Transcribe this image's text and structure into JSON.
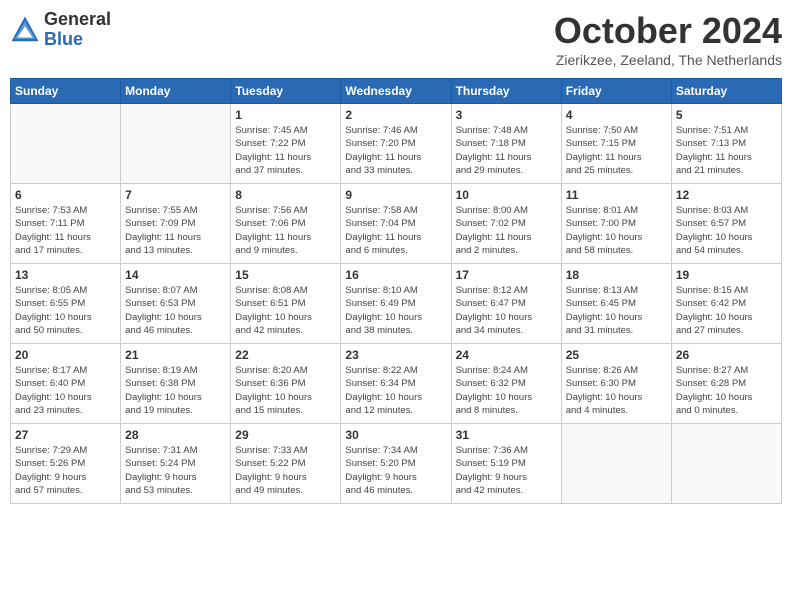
{
  "logo": {
    "general": "General",
    "blue": "Blue"
  },
  "title": "October 2024",
  "location": "Zierikzee, Zeeland, The Netherlands",
  "weekdays": [
    "Sunday",
    "Monday",
    "Tuesday",
    "Wednesday",
    "Thursday",
    "Friday",
    "Saturday"
  ],
  "weeks": [
    [
      {
        "day": "",
        "info": ""
      },
      {
        "day": "",
        "info": ""
      },
      {
        "day": "1",
        "info": "Sunrise: 7:45 AM\nSunset: 7:22 PM\nDaylight: 11 hours\nand 37 minutes."
      },
      {
        "day": "2",
        "info": "Sunrise: 7:46 AM\nSunset: 7:20 PM\nDaylight: 11 hours\nand 33 minutes."
      },
      {
        "day": "3",
        "info": "Sunrise: 7:48 AM\nSunset: 7:18 PM\nDaylight: 11 hours\nand 29 minutes."
      },
      {
        "day": "4",
        "info": "Sunrise: 7:50 AM\nSunset: 7:15 PM\nDaylight: 11 hours\nand 25 minutes."
      },
      {
        "day": "5",
        "info": "Sunrise: 7:51 AM\nSunset: 7:13 PM\nDaylight: 11 hours\nand 21 minutes."
      }
    ],
    [
      {
        "day": "6",
        "info": "Sunrise: 7:53 AM\nSunset: 7:11 PM\nDaylight: 11 hours\nand 17 minutes."
      },
      {
        "day": "7",
        "info": "Sunrise: 7:55 AM\nSunset: 7:09 PM\nDaylight: 11 hours\nand 13 minutes."
      },
      {
        "day": "8",
        "info": "Sunrise: 7:56 AM\nSunset: 7:06 PM\nDaylight: 11 hours\nand 9 minutes."
      },
      {
        "day": "9",
        "info": "Sunrise: 7:58 AM\nSunset: 7:04 PM\nDaylight: 11 hours\nand 6 minutes."
      },
      {
        "day": "10",
        "info": "Sunrise: 8:00 AM\nSunset: 7:02 PM\nDaylight: 11 hours\nand 2 minutes."
      },
      {
        "day": "11",
        "info": "Sunrise: 8:01 AM\nSunset: 7:00 PM\nDaylight: 10 hours\nand 58 minutes."
      },
      {
        "day": "12",
        "info": "Sunrise: 8:03 AM\nSunset: 6:57 PM\nDaylight: 10 hours\nand 54 minutes."
      }
    ],
    [
      {
        "day": "13",
        "info": "Sunrise: 8:05 AM\nSunset: 6:55 PM\nDaylight: 10 hours\nand 50 minutes."
      },
      {
        "day": "14",
        "info": "Sunrise: 8:07 AM\nSunset: 6:53 PM\nDaylight: 10 hours\nand 46 minutes."
      },
      {
        "day": "15",
        "info": "Sunrise: 8:08 AM\nSunset: 6:51 PM\nDaylight: 10 hours\nand 42 minutes."
      },
      {
        "day": "16",
        "info": "Sunrise: 8:10 AM\nSunset: 6:49 PM\nDaylight: 10 hours\nand 38 minutes."
      },
      {
        "day": "17",
        "info": "Sunrise: 8:12 AM\nSunset: 6:47 PM\nDaylight: 10 hours\nand 34 minutes."
      },
      {
        "day": "18",
        "info": "Sunrise: 8:13 AM\nSunset: 6:45 PM\nDaylight: 10 hours\nand 31 minutes."
      },
      {
        "day": "19",
        "info": "Sunrise: 8:15 AM\nSunset: 6:42 PM\nDaylight: 10 hours\nand 27 minutes."
      }
    ],
    [
      {
        "day": "20",
        "info": "Sunrise: 8:17 AM\nSunset: 6:40 PM\nDaylight: 10 hours\nand 23 minutes."
      },
      {
        "day": "21",
        "info": "Sunrise: 8:19 AM\nSunset: 6:38 PM\nDaylight: 10 hours\nand 19 minutes."
      },
      {
        "day": "22",
        "info": "Sunrise: 8:20 AM\nSunset: 6:36 PM\nDaylight: 10 hours\nand 15 minutes."
      },
      {
        "day": "23",
        "info": "Sunrise: 8:22 AM\nSunset: 6:34 PM\nDaylight: 10 hours\nand 12 minutes."
      },
      {
        "day": "24",
        "info": "Sunrise: 8:24 AM\nSunset: 6:32 PM\nDaylight: 10 hours\nand 8 minutes."
      },
      {
        "day": "25",
        "info": "Sunrise: 8:26 AM\nSunset: 6:30 PM\nDaylight: 10 hours\nand 4 minutes."
      },
      {
        "day": "26",
        "info": "Sunrise: 8:27 AM\nSunset: 6:28 PM\nDaylight: 10 hours\nand 0 minutes."
      }
    ],
    [
      {
        "day": "27",
        "info": "Sunrise: 7:29 AM\nSunset: 5:26 PM\nDaylight: 9 hours\nand 57 minutes."
      },
      {
        "day": "28",
        "info": "Sunrise: 7:31 AM\nSunset: 5:24 PM\nDaylight: 9 hours\nand 53 minutes."
      },
      {
        "day": "29",
        "info": "Sunrise: 7:33 AM\nSunset: 5:22 PM\nDaylight: 9 hours\nand 49 minutes."
      },
      {
        "day": "30",
        "info": "Sunrise: 7:34 AM\nSunset: 5:20 PM\nDaylight: 9 hours\nand 46 minutes."
      },
      {
        "day": "31",
        "info": "Sunrise: 7:36 AM\nSunset: 5:19 PM\nDaylight: 9 hours\nand 42 minutes."
      },
      {
        "day": "",
        "info": ""
      },
      {
        "day": "",
        "info": ""
      }
    ]
  ]
}
